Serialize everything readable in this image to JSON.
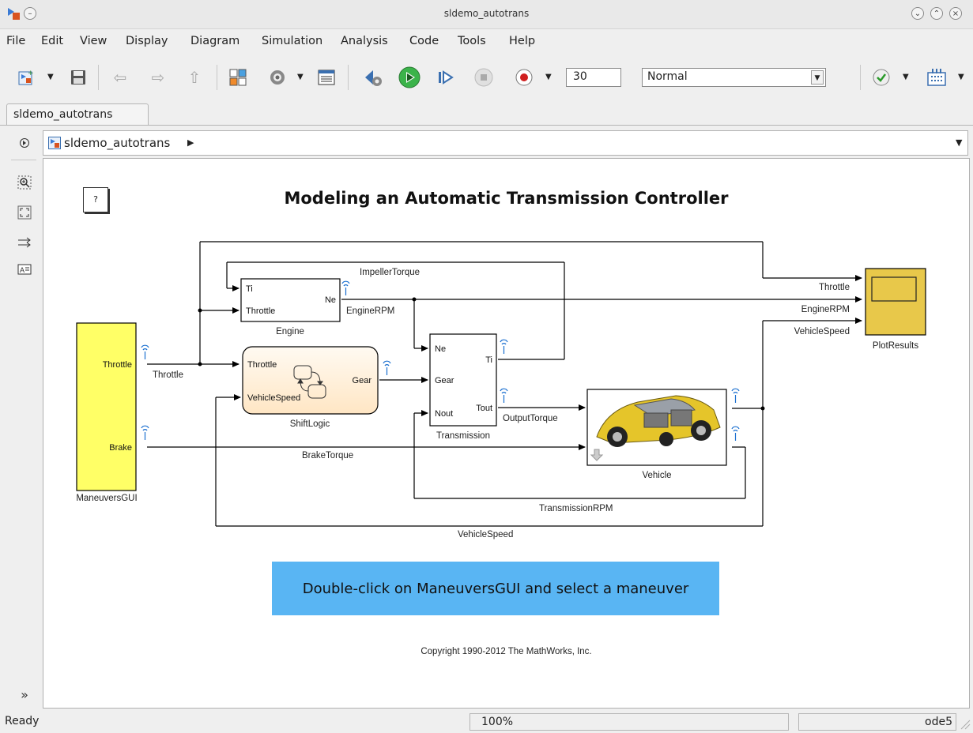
{
  "window": {
    "title": "sldemo_autotrans"
  },
  "menubar": {
    "items": [
      "File",
      "Edit",
      "View",
      "Display",
      "Diagram",
      "Simulation",
      "Analysis",
      "Code",
      "Tools",
      "Help"
    ]
  },
  "toolbar": {
    "stop_time": "30",
    "sim_mode": "Normal",
    "icons": [
      "new-model-icon",
      "save-icon",
      "back-icon",
      "forward-icon",
      "up-icon",
      "library-browser-icon",
      "model-config-icon",
      "model-explorer-icon",
      "step-back-icon",
      "run-icon",
      "step-forward-icon",
      "stop-icon",
      "record-icon",
      "check-icon",
      "build-icon"
    ]
  },
  "tabs": [
    {
      "label": "sldemo_autotrans"
    }
  ],
  "breadcrumb": {
    "path": "sldemo_autotrans"
  },
  "diagram": {
    "title": "Modeling an Automatic Transmission Controller",
    "help_label": "?",
    "banner": "Double-click on ManeuversGUI and select a maneuver",
    "copyright": "Copyright 1990-2012 The MathWorks, Inc.",
    "blocks": {
      "maneuvers": {
        "name": "ManeuversGUI",
        "ports": [
          "Throttle",
          "Brake"
        ]
      },
      "engine": {
        "name": "Engine",
        "in_ports": [
          "Ti",
          "Throttle"
        ],
        "out_ports": [
          "Ne"
        ]
      },
      "shiftlogic": {
        "name": "ShiftLogic",
        "in_ports": [
          "Throttle",
          "VehicleSpeed"
        ],
        "out_ports": [
          "Gear"
        ]
      },
      "transmission": {
        "name": "Transmission",
        "in_ports": [
          "Ne",
          "Gear",
          "Nout"
        ],
        "out_ports": [
          "Ti",
          "Tout"
        ]
      },
      "vehicle": {
        "name": "Vehicle"
      },
      "plotresults": {
        "name": "PlotResults"
      }
    },
    "signals": {
      "throttle": "Throttle",
      "impeller": "ImpellerTorque",
      "engine_rpm": "EngineRPM",
      "output_torque": "OutputTorque",
      "brake_torque": "BrakeTorque",
      "transmission_rpm": "TransmissionRPM",
      "vehicle_speed": "VehicleSpeed",
      "plot_throttle": "Throttle",
      "plot_engine_rpm": "EngineRPM",
      "plot_vehicle_speed": "VehicleSpeed"
    }
  },
  "statusbar": {
    "status": "Ready",
    "zoom": "100%",
    "solver": "ode5"
  }
}
